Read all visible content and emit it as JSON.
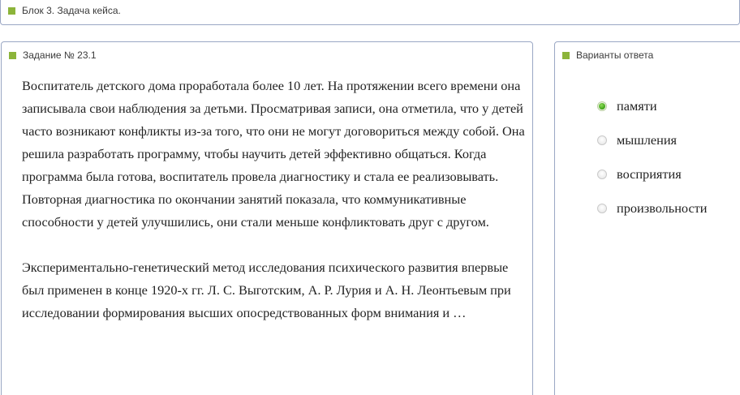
{
  "block": {
    "title": "Блок 3. Задача кейса."
  },
  "task": {
    "title": "Задание № 23.1",
    "paragraphs": [
      "Воспитатель детского дома проработала более 10 лет. На протяжении всего времени она записывала свои наблюдения за детьми. Просматривая записи, она отметила, что у детей часто возникают конфликты из-за того, что они не могут договориться между собой. Она решила разработать программу, чтобы научить детей эффективно общаться. Когда программа была готова, воспитатель провела диагностику и стала ее реализовывать. Повторная диагностика по окончании занятий показала, что коммуникативные способности у детей улучшились, они стали меньше конфликтовать друг с другом.",
      "Экспериментально-генетический метод исследования психического развития впервые был применен в конце 1920-х гг. Л. С. Выготским, А. Р. Лурия и А. Н. Леонтьевым при исследовании формирования высших опосредствованных форм внимания и …"
    ]
  },
  "answers": {
    "title": "Варианты ответа",
    "options": [
      {
        "label": "памяти",
        "selected": true
      },
      {
        "label": "мышления",
        "selected": false
      },
      {
        "label": "восприятия",
        "selected": false
      },
      {
        "label": "произвольности",
        "selected": false
      }
    ]
  },
  "colors": {
    "marker": "#8cb43a",
    "panel_border": "#9aa7c4",
    "radio_selected": "#3aa113"
  }
}
